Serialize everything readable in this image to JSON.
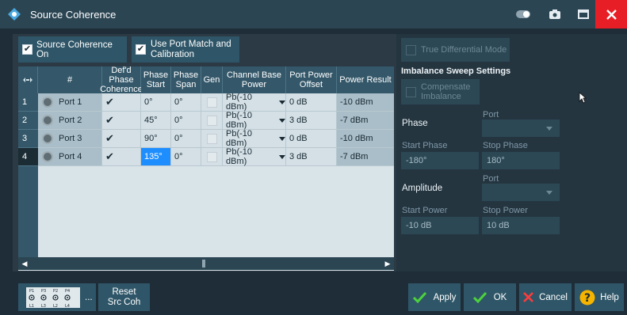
{
  "window": {
    "title": "Source Coherence",
    "colors": {
      "titlebar": "#2b4553",
      "close": "#e81e26",
      "accent": "#1e8eff"
    }
  },
  "top_controls": {
    "source_coherence_on": {
      "label": "Source Coherence On",
      "checked": true
    },
    "use_port_match": {
      "label_line1": "Use Port Match and",
      "label_line2": "Calibration",
      "checked": true
    }
  },
  "table": {
    "columns": {
      "num": "#",
      "defd_line1": "Def'd Phase",
      "defd_line2": "Coherence",
      "phase_start_line1": "Phase",
      "phase_start_line2": "Start",
      "phase_span_line1": "Phase",
      "phase_span_line2": "Span",
      "gen": "Gen",
      "base_line1": "Channel Base",
      "base_line2": "Power",
      "offset_line1": "Port Power",
      "offset_line2": "Offset",
      "result": "Power Result"
    },
    "rows": [
      {
        "idx": "1",
        "port": "Port 1",
        "defd": true,
        "phase_start": "0°",
        "phase_span": "0°",
        "gen": false,
        "base_power": "Pb(-10 dBm)",
        "offset": "0 dB",
        "result": "-10 dBm"
      },
      {
        "idx": "2",
        "port": "Port 2",
        "defd": true,
        "phase_start": "45°",
        "phase_span": "0°",
        "gen": false,
        "base_power": "Pb(-10 dBm)",
        "offset": "3 dB",
        "result": "-7 dBm"
      },
      {
        "idx": "3",
        "port": "Port 3",
        "defd": true,
        "phase_start": "90°",
        "phase_span": "0°",
        "gen": false,
        "base_power": "Pb(-10 dBm)",
        "offset": "0 dB",
        "result": "-10 dBm"
      },
      {
        "idx": "4",
        "port": "Port 4",
        "defd": true,
        "phase_start": "135°",
        "phase_span": "0°",
        "gen": false,
        "base_power": "Pb(-10 dBm)",
        "offset": "3 dB",
        "result": "-7 dBm"
      }
    ],
    "selected_row": "4",
    "editing_cell": "phase_start"
  },
  "right_panel": {
    "true_diff": "True Differential Mode",
    "imbalance_title": "Imbalance Sweep Settings",
    "compensate_line1": "Compensate",
    "compensate_line2": "Imbalance",
    "phase": {
      "title": "Phase",
      "port_label": "Port",
      "start_label": "Start Phase",
      "stop_label": "Stop Phase",
      "start_value": "-180°",
      "stop_value": "180°"
    },
    "amplitude": {
      "title": "Amplitude",
      "port_label": "Port",
      "start_label": "Start Power",
      "stop_label": "Stop Power",
      "start_value": "-10 dB",
      "stop_value": "10 dB"
    }
  },
  "bottom": {
    "port_topo": {
      "top": [
        "P1",
        "P3",
        "P2",
        "P4"
      ],
      "bottom": [
        "L1",
        "L3",
        "L2",
        "L4"
      ],
      "ellipsis": "..."
    },
    "reset_line1": "Reset",
    "reset_line2": "Src Coh",
    "apply": "Apply",
    "ok": "OK",
    "cancel": "Cancel",
    "help": "Help"
  }
}
